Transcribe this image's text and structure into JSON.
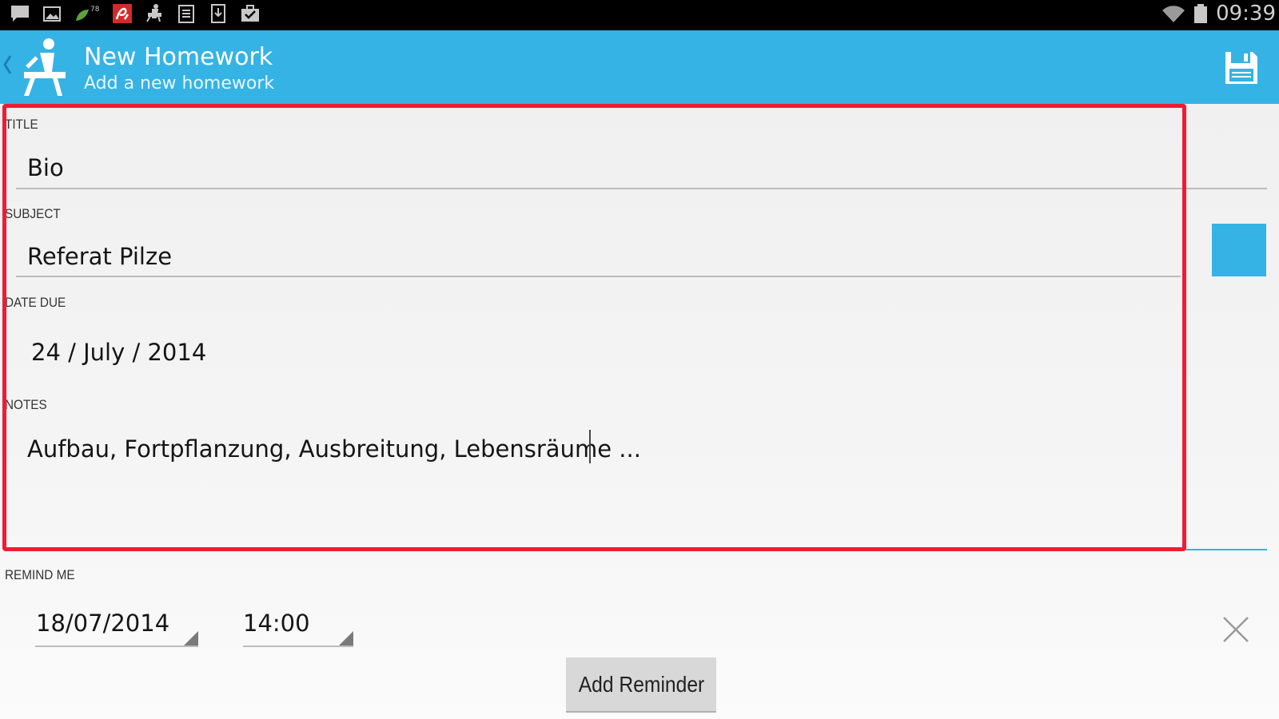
{
  "status_bar": {
    "icons": [
      "message-icon",
      "image-icon",
      "leaf-icon",
      "avira-icon",
      "homework-app-icon",
      "clipboard-icon",
      "download-icon",
      "briefcase-check-icon"
    ],
    "badge": "78",
    "time": "09:39"
  },
  "action_bar": {
    "title": "New Homework",
    "subtitle": "Add a new homework"
  },
  "form": {
    "title": {
      "label": "TITLE",
      "value": "Bio"
    },
    "subject": {
      "label": "SUBJECT",
      "value": "Referat Pilze"
    },
    "date_due": {
      "label": "DATE DUE",
      "value": "24 / July / 2014"
    },
    "notes": {
      "label": "NOTES",
      "value": "Aufbau, Fortpflanzung, Ausbreitung, Lebensräume ..."
    },
    "remind": {
      "label": "REMIND ME",
      "date": "18/07/2014",
      "time": "14:00",
      "add_label": "Add Reminder"
    }
  },
  "colors": {
    "accent": "#35b3e5",
    "highlight": "#ee1c34",
    "status_bar": "#000000"
  }
}
